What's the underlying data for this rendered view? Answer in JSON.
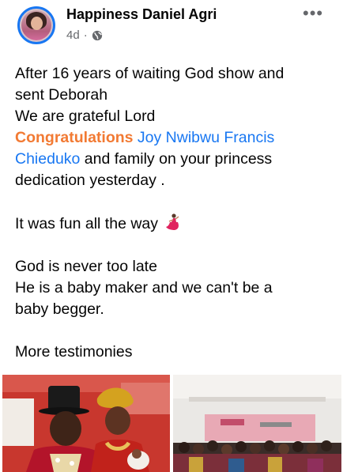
{
  "post": {
    "author": "Happiness Daniel Agri",
    "time": "4d",
    "dot": "·",
    "more_label": "•••",
    "lines": {
      "l1": "After 16 years of waiting God show and",
      "l2": "sent Deborah",
      "l3": "We are grateful Lord",
      "l4_orange": "Congratulations",
      "l4_link": "Joy Nwibwu Francis",
      "l5_link": "Chieduko",
      "l5_rest": " and family on your princess",
      "l6": "dedication yesterday  .",
      "l7": " It was fun all the way ",
      "l8": "God is never too late",
      "l9": "He is a baby maker and we can't be a",
      "l10": "baby begger.",
      "l11": "More testimonies"
    }
  },
  "icons": {
    "avatar": "profile-avatar",
    "audience": "globe-icon",
    "menu": "more-options-icon",
    "emoji": "dancer-emoji-icon"
  },
  "colors": {
    "link": "#1877f2",
    "accent_orange": "#f27a33",
    "meta_gray": "#65676b",
    "avatar_ring": "#1877f2"
  }
}
